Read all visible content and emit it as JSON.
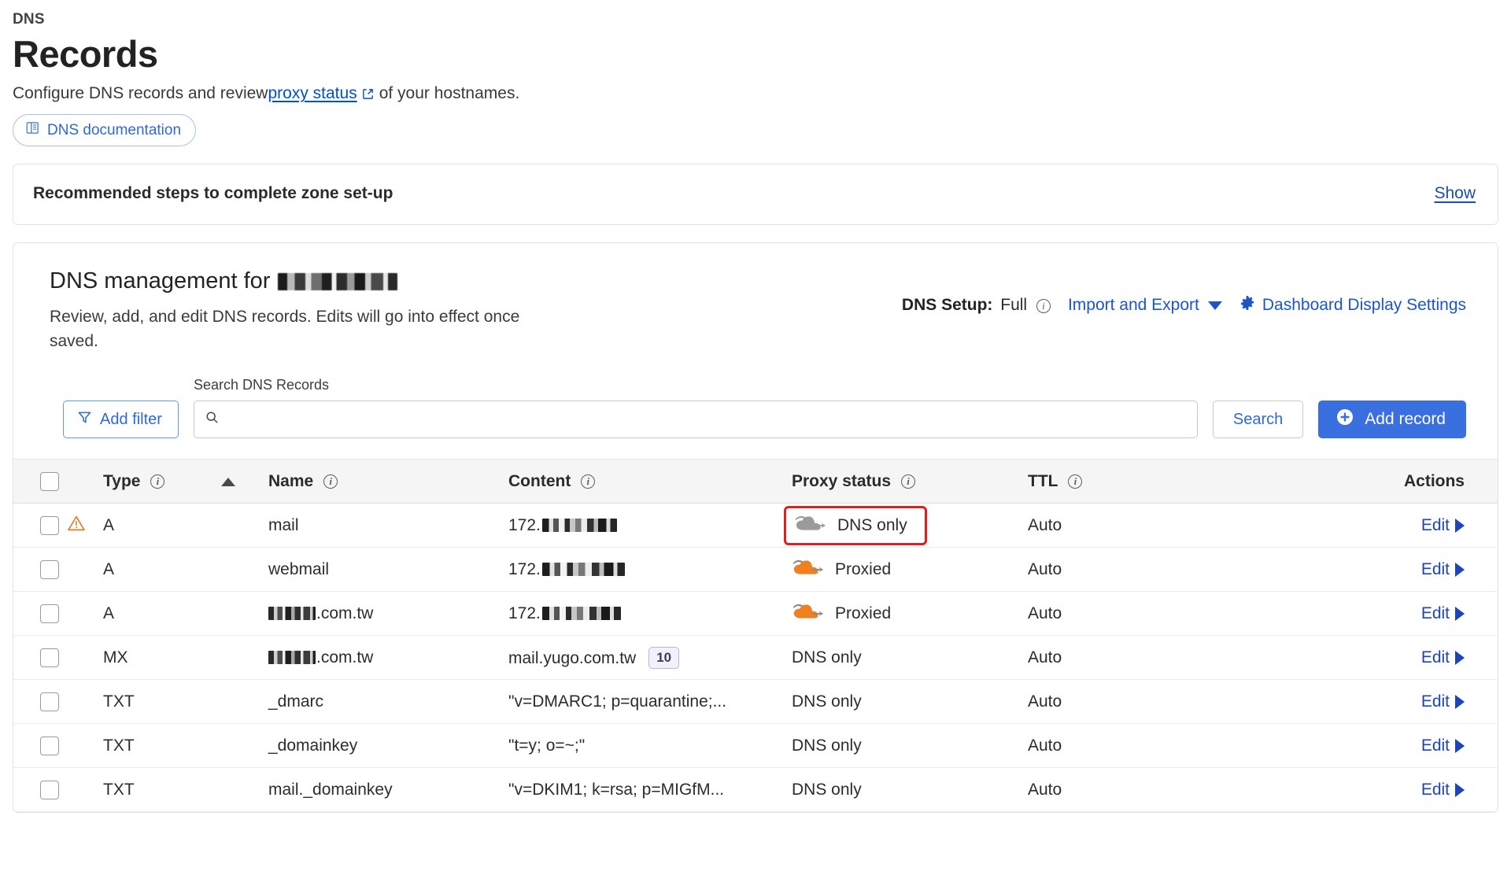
{
  "header": {
    "breadcrumb": "DNS",
    "title": "Records",
    "subtitle_before": "Configure DNS records and review ",
    "subtitle_link": "proxy status",
    "subtitle_after": "of your hostnames.",
    "doc_button": "DNS documentation"
  },
  "banner": {
    "title": "Recommended steps to complete zone set-up",
    "show_label": "Show"
  },
  "management": {
    "heading_prefix": "DNS management for",
    "heading_domain_redacted": true,
    "description": "Review, add, and edit DNS records. Edits will go into effect once saved.",
    "dns_setup_label": "DNS Setup:",
    "dns_setup_value": "Full",
    "import_export": "Import and Export",
    "dashboard_settings": "Dashboard Display Settings"
  },
  "toolbar": {
    "add_filter": "Add filter",
    "search_label": "Search DNS Records",
    "search_value": "",
    "search_placeholder": "",
    "search_button": "Search",
    "add_record": "Add record"
  },
  "table": {
    "columns": {
      "type": "Type",
      "name": "Name",
      "content": "Content",
      "proxy_status": "Proxy status",
      "ttl": "TTL",
      "actions": "Actions"
    },
    "sort_column": "Name",
    "sort_direction": "ascending",
    "edit_label": "Edit",
    "rows": [
      {
        "warning": true,
        "type": "A",
        "name": "mail",
        "name_redacted": false,
        "content": "172.",
        "content_redacted": true,
        "content_redact_width": 95,
        "priority": null,
        "proxy_status": "DNS only",
        "proxy_icon": "cloud-gray-arrow-icon",
        "highlighted": true,
        "ttl": "Auto"
      },
      {
        "warning": false,
        "type": "A",
        "name": "webmail",
        "name_redacted": false,
        "content": "172.",
        "content_redacted": true,
        "content_redact_width": 105,
        "priority": null,
        "proxy_status": "Proxied",
        "proxy_icon": "cloud-orange-arrow-icon",
        "highlighted": false,
        "ttl": "Auto"
      },
      {
        "warning": false,
        "type": "A",
        "name": ".com.tw",
        "name_redacted": true,
        "name_redact_width": 60,
        "content": "172.",
        "content_redacted": true,
        "content_redact_width": 100,
        "priority": null,
        "proxy_status": "Proxied",
        "proxy_icon": "cloud-orange-arrow-icon",
        "highlighted": false,
        "ttl": "Auto"
      },
      {
        "warning": false,
        "type": "MX",
        "name": ".com.tw",
        "name_redacted": true,
        "name_redact_width": 60,
        "content": "mail.yugo.com.tw",
        "content_redacted": false,
        "priority": "10",
        "proxy_status": "DNS only",
        "proxy_icon": null,
        "highlighted": false,
        "ttl": "Auto"
      },
      {
        "warning": false,
        "type": "TXT",
        "name": "_dmarc",
        "name_redacted": false,
        "content": "\"v=DMARC1; p=quarantine;...",
        "content_redacted": false,
        "priority": null,
        "proxy_status": "DNS only",
        "proxy_icon": null,
        "highlighted": false,
        "ttl": "Auto"
      },
      {
        "warning": false,
        "type": "TXT",
        "name": "_domainkey",
        "name_redacted": false,
        "content": "\"t=y; o=~;\"",
        "content_redacted": false,
        "priority": null,
        "proxy_status": "DNS only",
        "proxy_icon": null,
        "highlighted": false,
        "ttl": "Auto"
      },
      {
        "warning": false,
        "type": "TXT",
        "name": "mail._domainkey",
        "name_redacted": false,
        "content": "\"v=DKIM1; k=rsa; p=MIGfM...",
        "content_redacted": false,
        "priority": null,
        "proxy_status": "DNS only",
        "proxy_icon": null,
        "highlighted": false,
        "ttl": "Auto"
      }
    ]
  },
  "colors": {
    "accent_blue": "#3a6fe0",
    "link_blue": "#1b56c4",
    "proxied_orange": "#f08020",
    "dns_only_gray": "#9b9b9b",
    "warning_orange": "#d9822b",
    "highlight_red": "#e02020"
  }
}
